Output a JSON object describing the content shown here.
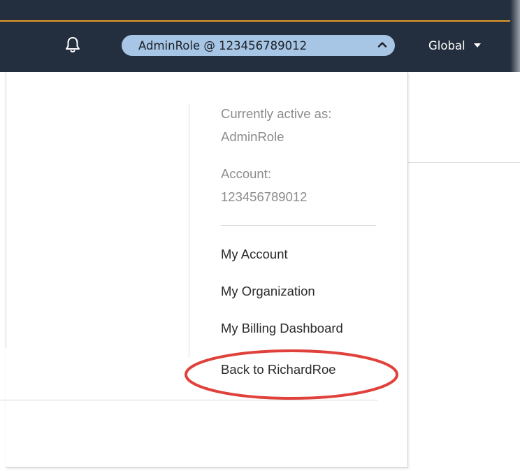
{
  "topbar": {
    "role_pill_label": "AdminRole @ 123456789012",
    "region_label": "Global"
  },
  "dropdown": {
    "active_label": "Currently active as:",
    "active_value": "AdminRole",
    "account_label": "Account:",
    "account_value": "123456789012",
    "items": [
      {
        "label": "My Account"
      },
      {
        "label": "My Organization"
      },
      {
        "label": "My Billing Dashboard"
      },
      {
        "label": "Back to RichardRoe"
      }
    ]
  },
  "colors": {
    "topbar_bg": "#232f3e",
    "accent_line": "#e69a2a",
    "role_pill_bg": "#a7c5e4",
    "highlight_ellipse": "#e0413b"
  },
  "icons": {
    "notifications": "bell-icon",
    "role_toggle": "chevron-up-icon",
    "region_toggle": "caret-down-icon"
  }
}
